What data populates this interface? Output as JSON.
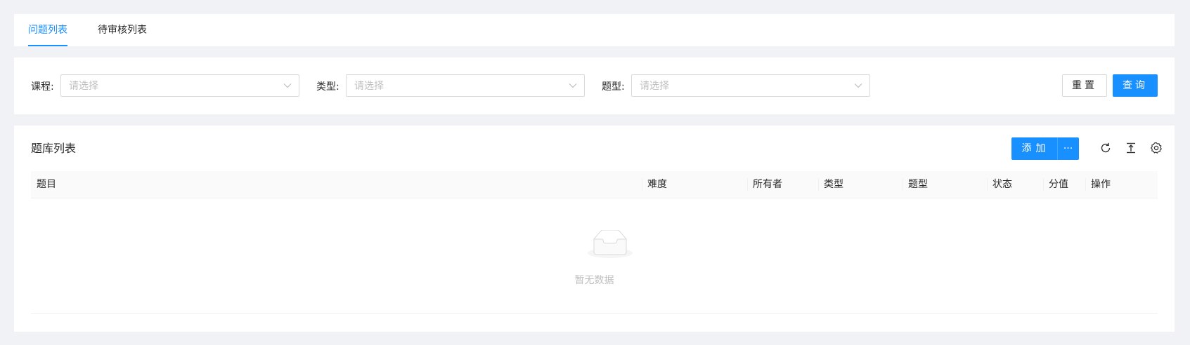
{
  "tabs": [
    {
      "label": "问题列表",
      "active": true
    },
    {
      "label": "待审核列表",
      "active": false
    }
  ],
  "filters": [
    {
      "label": "课程:",
      "placeholder": "请选择"
    },
    {
      "label": "类型:",
      "placeholder": "请选择"
    },
    {
      "label": "题型:",
      "placeholder": "请选择"
    }
  ],
  "actions": {
    "reset_label": "重置",
    "query_label": "查询"
  },
  "table": {
    "title": "题库列表",
    "add_label": "添加",
    "more_label": "···",
    "columns": [
      "题目",
      "难度",
      "所有者",
      "类型",
      "题型",
      "状态",
      "分值",
      "操作"
    ],
    "rows": [],
    "empty_text": "暂无数据"
  },
  "colors": {
    "primary": "#1890ff",
    "background": "#f0f2f5",
    "border": "#d9d9d9"
  },
  "icons": {
    "select_arrow": "chevron-down-icon",
    "refresh": "reload-icon",
    "export": "vertical-align-top-icon",
    "settings": "setting-icon",
    "empty": "empty-inbox-icon"
  }
}
